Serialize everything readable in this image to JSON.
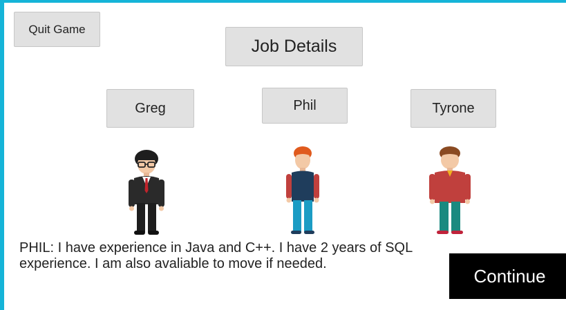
{
  "header": {
    "quit_label": "Quit Game",
    "job_details_label": "Job Details"
  },
  "candidates": [
    {
      "name": "Greg",
      "icon": "businessman-avatar-icon",
      "suit_color": "#2a2a2a",
      "tie_color": "#c0232b"
    },
    {
      "name": "Phil",
      "icon": "casual-man-avatar-icon",
      "shirt_color": "#1f3d5c",
      "pants_color": "#1b9cc4",
      "hair_color": "#e05a1d"
    },
    {
      "name": "Tyrone",
      "icon": "sweater-man-avatar-icon",
      "sweater_color": "#c0403d",
      "pants_color": "#1a8a80",
      "hair_color": "#8a4a22"
    }
  ],
  "dialog": {
    "text": "PHIL: I have experience in Java and C++. I have 2 years of SQL experience. I am also avaliable to move if needed."
  },
  "footer": {
    "continue_label": "Continue"
  },
  "colors": {
    "frame": "#15b4d8",
    "button_bg": "#e1e1e1",
    "continue_bg": "#000000"
  }
}
